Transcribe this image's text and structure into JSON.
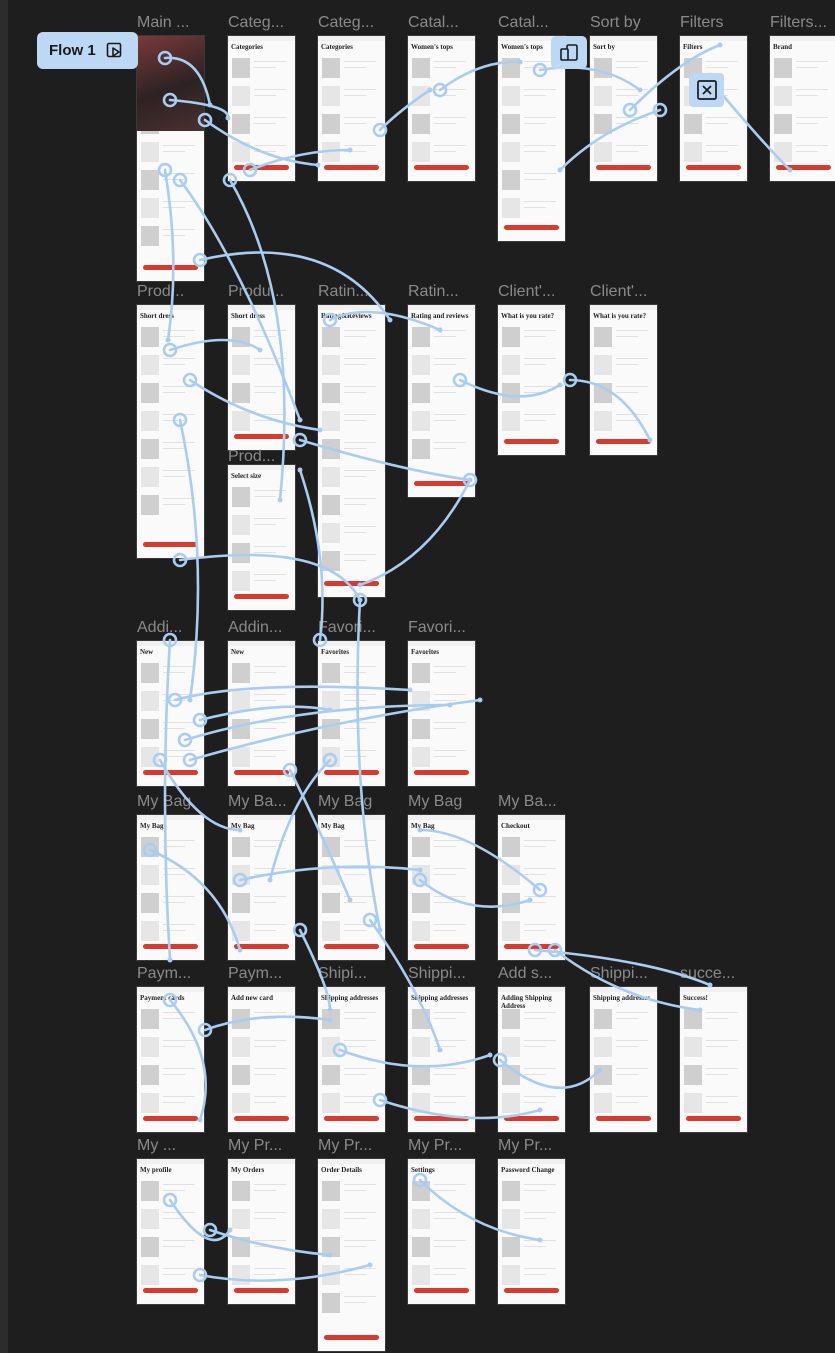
{
  "flow_badge": {
    "label": "Flow 1",
    "icon": "flow-play-icon"
  },
  "frames": [
    {
      "label": "Main ...",
      "screen_title": "Fashion sale"
    },
    {
      "label": "Categ...",
      "screen_title": "Categories"
    },
    {
      "label": "Categ...",
      "screen_title": "Categories"
    },
    {
      "label": "Catal...",
      "screen_title": "Women's tops"
    },
    {
      "label": "Catal...",
      "screen_title": "Women's tops"
    },
    {
      "label": "Sort by",
      "screen_title": "Sort by"
    },
    {
      "label": "Filters",
      "screen_title": "Filters"
    },
    {
      "label": "Filters...",
      "screen_title": "Brand"
    },
    {
      "label": "Prod...",
      "screen_title": "Short dress"
    },
    {
      "label": "Produ...",
      "screen_title": "Short dress"
    },
    {
      "label": "Ratin...",
      "screen_title": "Rating&Reviews"
    },
    {
      "label": "Ratin...",
      "screen_title": "Rating and reviews"
    },
    {
      "label": "Client'...",
      "screen_title": "What is you rate?"
    },
    {
      "label": "Client'...",
      "screen_title": "What is you rate?"
    },
    {
      "label": "Prod...",
      "screen_title": "Select size"
    },
    {
      "label": "Addi...",
      "screen_title": "New"
    },
    {
      "label": "Addin...",
      "screen_title": "New"
    },
    {
      "label": "Favori...",
      "screen_title": "Favorites"
    },
    {
      "label": "Favori...",
      "screen_title": "Favorites"
    },
    {
      "label": "My Bag",
      "screen_title": "My Bag"
    },
    {
      "label": "My Ba...",
      "screen_title": "My Bag"
    },
    {
      "label": "My Bag",
      "screen_title": "My Bag"
    },
    {
      "label": "My Bag",
      "screen_title": "My Bag"
    },
    {
      "label": "My Ba...",
      "screen_title": "Checkout"
    },
    {
      "label": "Paym...",
      "screen_title": "Payment cards"
    },
    {
      "label": "Paym...",
      "screen_title": "Add new card"
    },
    {
      "label": "Shipi...",
      "screen_title": "Shipping addresses"
    },
    {
      "label": "Shippi...",
      "screen_title": "Shipping addresses"
    },
    {
      "label": "Add s...",
      "screen_title": "Adding Shipping Address"
    },
    {
      "label": "Shippi...",
      "screen_title": "Shipping addresses"
    },
    {
      "label": "succe...",
      "screen_title": "Success!"
    },
    {
      "label": "My ...",
      "screen_title": "My profile"
    },
    {
      "label": "My Pr...",
      "screen_title": "My Orders"
    },
    {
      "label": "My Pr...",
      "screen_title": "Order Details"
    },
    {
      "label": "My Pr...",
      "screen_title": "Settings"
    },
    {
      "label": "My Pr...",
      "screen_title": "Password Change"
    }
  ],
  "colors": {
    "canvas": "#1e1e1e",
    "link": "#a9cdf2",
    "accent": "#d63b2f",
    "label": "#8a8a8a"
  },
  "icons": {
    "prototype": "device-frame-icon",
    "close": "close-x-icon"
  }
}
